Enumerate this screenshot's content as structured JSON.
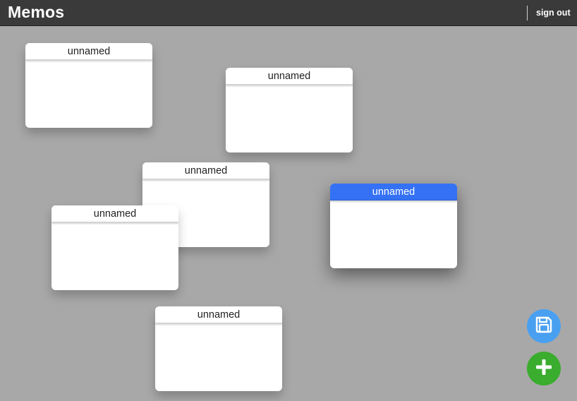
{
  "header": {
    "title": "Memos",
    "signout_label": "sign out"
  },
  "memos": [
    {
      "title": "unnamed",
      "active": false
    },
    {
      "title": "unnamed",
      "active": false
    },
    {
      "title": "unnamed",
      "active": false
    },
    {
      "title": "unnamed",
      "active": false
    },
    {
      "title": "unnamed",
      "active": true
    },
    {
      "title": "unnamed",
      "active": false
    }
  ],
  "actions": {
    "save_icon": "floppy-disk-icon",
    "add_icon": "plus-icon"
  },
  "colors": {
    "topbar": "#3a3a3a",
    "board": "#a8a8a8",
    "active_memo_header": "#3471f4",
    "save_button": "#4aa0f0",
    "add_button": "#3aac2e"
  }
}
